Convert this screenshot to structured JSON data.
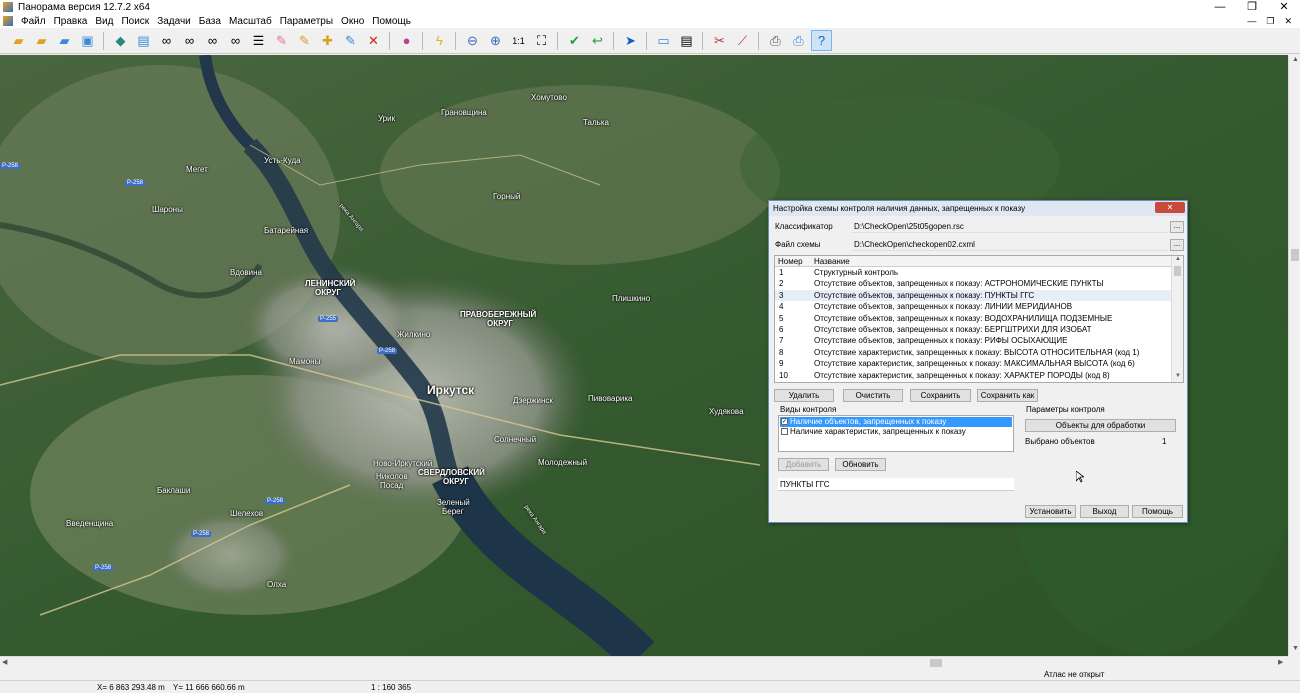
{
  "window": {
    "title": "Панорама версия 12.7.2 x64",
    "minimize": "—",
    "maximize": "❐",
    "close": "✕"
  },
  "menu": [
    "Файл",
    "Правка",
    "Вид",
    "Поиск",
    "Задачи",
    "База",
    "Масштаб",
    "Параметры",
    "Окно",
    "Помощь"
  ],
  "mdi": {
    "minimize": "—",
    "restore": "❐",
    "close": "✕"
  },
  "toolbar": {
    "zoom_one": "1:1"
  },
  "map": {
    "labels": {
      "khomutovo": "Хомутово",
      "urik": "Урик",
      "granovshchina": "Грановщина",
      "talka": "Талька",
      "ust_kuda": "Усть-Куда",
      "meget": "Мегет",
      "gorny": "Горный",
      "sharony": "Шароны",
      "batareynaya": "Батарейная",
      "vdovina": "Вдовина",
      "leninsky1": "ЛЕНИНСКИЙ",
      "leninsky2": "ОКРУГ",
      "pravoberezhny1": "ПРАВОБЕРЕЖНЫЙ",
      "pravoberezhny2": "ОКРУГ",
      "plishkino": "Плишкино",
      "zhilkino": "Жилкино",
      "mamony": "Мамоны",
      "irkutsk": "Иркутск",
      "dzerzhinsk": "Дзержинск",
      "pivovarikha": "Пивоварика",
      "khudyakova": "Худякова",
      "solnechny": "Солнечный",
      "novo_irkutsky": "Ново-Иркутский",
      "nikolov_posad1": "Николов",
      "nikolov_posad2": "Посад",
      "sverdlovsky1": "СВЕРДЛОВСКИЙ",
      "sverdlovsky2": "ОКРУГ",
      "molodezhny": "Молодежный",
      "baklashi": "Баклаши",
      "shelekhov": "Шелехов",
      "vvedenshchina": "Введенщина",
      "zeleny1": "Зеленый",
      "zeleny2": "Берег",
      "olkha": "Олха",
      "river_angara1": "река Ангара",
      "river_angara2": "река Ангара"
    },
    "roads": [
      "Р-258",
      "Р-258",
      "Р-255",
      "Р-258",
      "Р-258",
      "Р-258",
      "Р-258"
    ]
  },
  "dialog": {
    "title": "Настройка схемы контроля наличия данных, запрещенных к показу",
    "close": "✕",
    "classifier_label": "Классификатор",
    "classifier_value": "D:\\CheckOpen\\25t05gopen.rsc",
    "scheme_label": "Файл схемы",
    "scheme_value": "D:\\CheckOpen\\checkopen02.cxml",
    "browse": "...",
    "grid": {
      "col_number": "Номер",
      "col_name": "Название",
      "rows": [
        {
          "n": "1",
          "t": "Структурный контроль"
        },
        {
          "n": "2",
          "t": "Отсутствие объектов, запрещенных к показу: АСТРОНОМИЧЕСКИЕ ПУНКТЫ"
        },
        {
          "n": "3",
          "t": "Отсутствие объектов, запрещенных к показу: ПУНКТЫ ГГС"
        },
        {
          "n": "4",
          "t": "Отсутствие объектов, запрещенных к показу: ЛИНИИ МЕРИДИАНОВ"
        },
        {
          "n": "5",
          "t": "Отсутствие объектов, запрещенных к показу: ВОДОХРАНИЛИЩА ПОДЗЕМНЫЕ"
        },
        {
          "n": "6",
          "t": "Отсутствие объектов, запрещенных к показу: БЕРГШТРИХИ ДЛЯ ИЗОБАТ"
        },
        {
          "n": "7",
          "t": "Отсутствие объектов, запрещенных к показу: РИФЫ ОСЫХАЮЩИЕ"
        },
        {
          "n": "8",
          "t": "Отсутствие характеристик, запрещенных к показу: ВЫСОТА ОТНОСИТЕЛЬНАЯ (код 1)"
        },
        {
          "n": "9",
          "t": "Отсутствие характеристик, запрещенных к показу: МАКСИМАЛЬНАЯ ВЫСОТА (код 6)"
        },
        {
          "n": "10",
          "t": "Отсутствие характеристик, запрещенных к показу: ХАРАКТЕР ПОРОДЫ (код 8)"
        }
      ]
    },
    "buttons": {
      "delete": "Удалить",
      "clear": "Очистить",
      "save": "Сохранить",
      "save_as": "Сохранить как"
    },
    "control_types_label": "Виды контроля",
    "control_types": [
      {
        "label": "Наличие объектов, запрещенных к показу",
        "checked": "✓"
      },
      {
        "label": "Наличие характеристик, запрещенных к показу",
        "checked": ""
      }
    ],
    "add": "Добавить",
    "refresh": "Обновить",
    "name_value": "ПУНКТЫ ГГС",
    "params_label": "Параметры контроля",
    "objects_button": "Объекты для обработки",
    "selected_label": "Выбрано объектов",
    "selected_count": "1",
    "install": "Установить",
    "exit": "Выход",
    "help": "Помощь"
  },
  "infobar": {
    "atlas": "Атлас не открыт"
  },
  "status": {
    "x": "X= 6 863 293.48 m",
    "y": "Y= 11 666 660.66 m",
    "scale": "1 : 160 365"
  }
}
